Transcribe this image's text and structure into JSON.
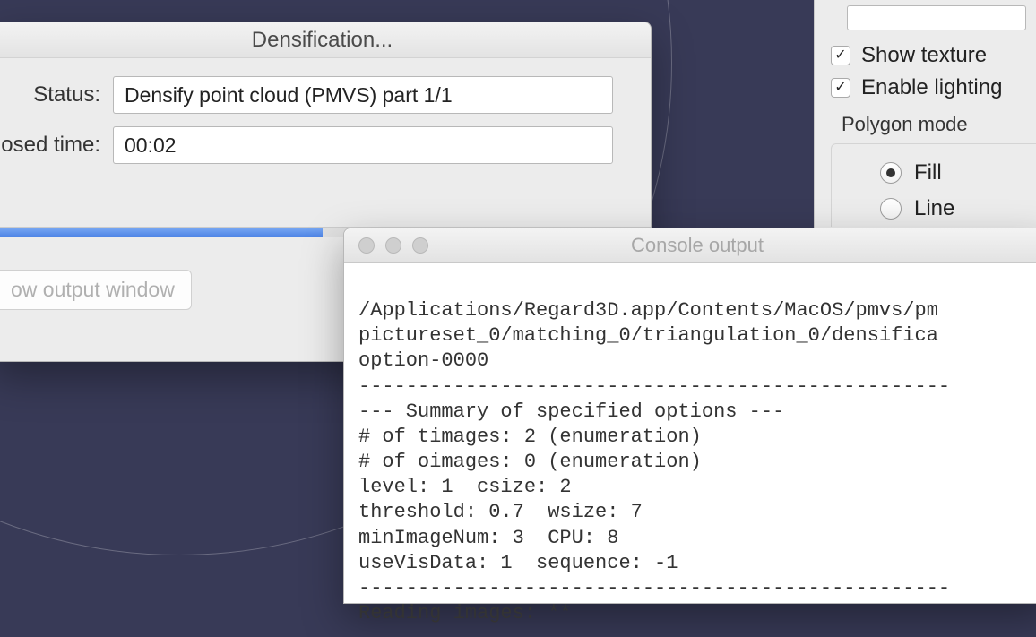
{
  "right_panel": {
    "show_texture": "Show texture",
    "enable_lighting": "Enable lighting",
    "polygon_mode_label": "Polygon mode",
    "fill": "Fill",
    "line": "Line"
  },
  "dialog": {
    "title": "Densification...",
    "status_label": "Status:",
    "status_value": "Densify point cloud (PMVS) part 1/1",
    "elapsed_label": "osed time:",
    "elapsed_value": "00:02",
    "output_button": "ow output window"
  },
  "console": {
    "title": "Console output",
    "lines": [
      "",
      "/Applications/Regard3D.app/Contents/MacOS/pmvs/pm",
      "pictureset_0/matching_0/triangulation_0/densifica",
      "option-0000",
      "--------------------------------------------------",
      "--- Summary of specified options ---",
      "# of timages: 2 (enumeration)",
      "# of oimages: 0 (enumeration)",
      "level: 1  csize: 2",
      "threshold: 0.7  wsize: 7",
      "minImageNum: 3  CPU: 8",
      "useVisData: 1  sequence: -1",
      "--------------------------------------------------",
      "Reading images: **"
    ]
  }
}
